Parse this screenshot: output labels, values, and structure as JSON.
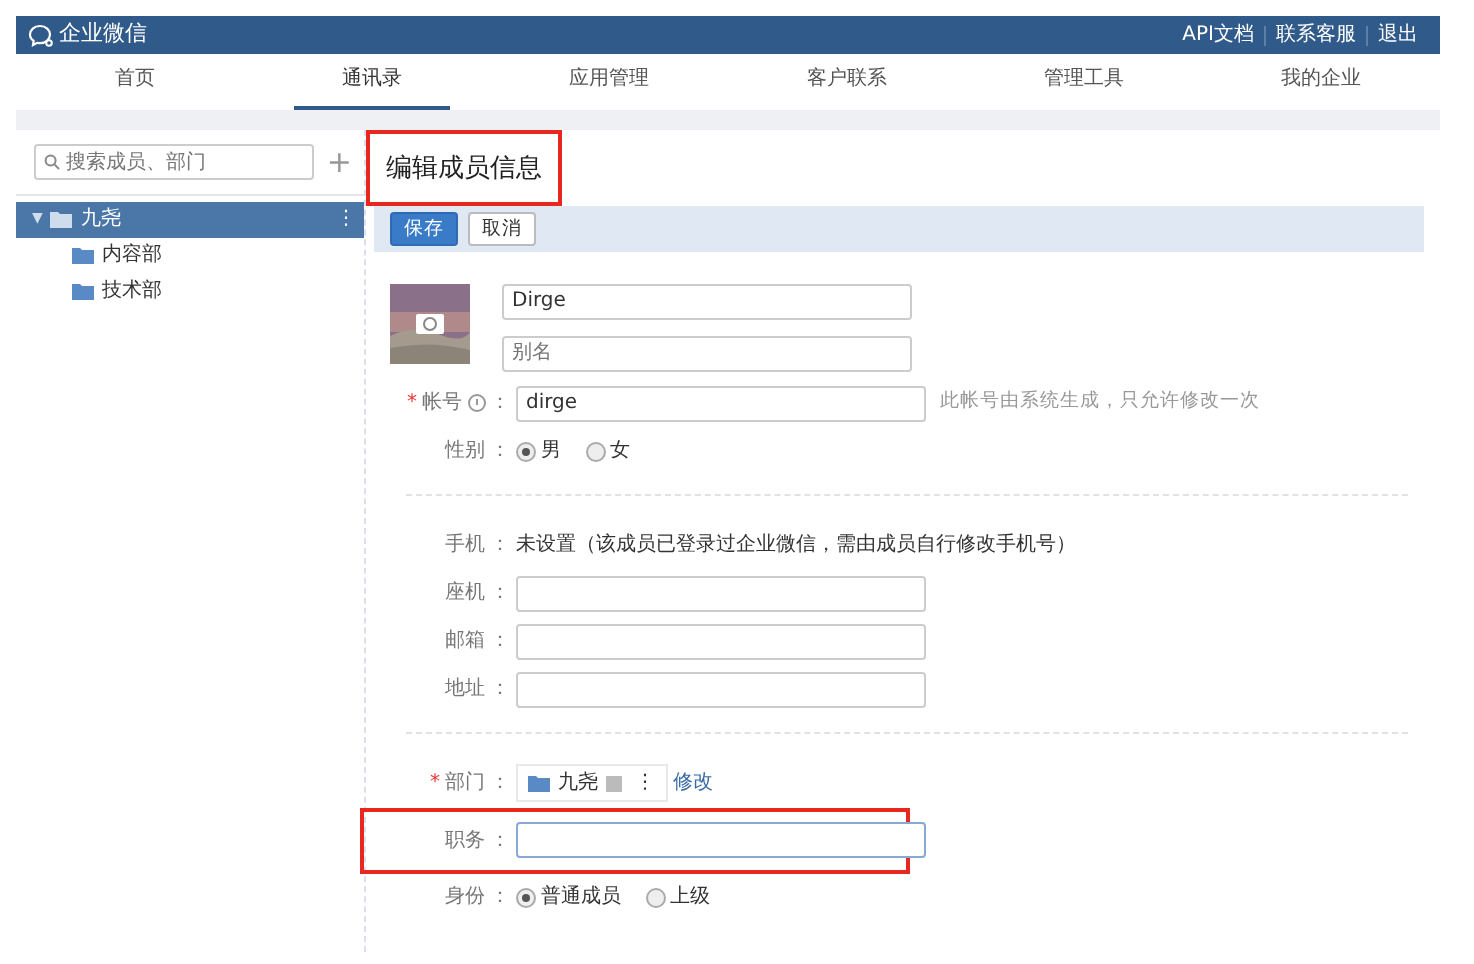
{
  "header": {
    "logo": "企业微信",
    "links": [
      "API文档",
      "联系客服",
      "退出"
    ]
  },
  "nav": [
    {
      "label": "首页",
      "selected": false
    },
    {
      "label": "通讯录",
      "selected": true
    },
    {
      "label": "应用管理",
      "selected": false
    },
    {
      "label": "客户联系",
      "selected": false
    },
    {
      "label": "管理工具",
      "selected": false
    },
    {
      "label": "我的企业",
      "selected": false
    }
  ],
  "sidebar": {
    "search_placeholder": "搜索成员、部门",
    "add": "+",
    "tree": [
      {
        "label": "九尧",
        "selected": true,
        "expanded": true,
        "caret": "▼",
        "more": "⋮",
        "children": [
          {
            "label": "内容部",
            "selected": false
          },
          {
            "label": "技术部",
            "selected": false
          }
        ]
      }
    ]
  },
  "page_title": {
    "text": "编辑成员信息",
    "highlighted": true
  },
  "toolbar": [
    {
      "label": "保存",
      "kind": "primary"
    },
    {
      "label": "取消",
      "kind": "default"
    }
  ],
  "profile": {
    "name": "Dirge",
    "alias_placeholder": "别名"
  },
  "fields": [
    {
      "kind": "text",
      "required_mark": "*",
      "label": "帐号",
      "info": true,
      "colon": "：",
      "value": "dirge",
      "hint": "此帐号由系统生成，只允许修改一次"
    },
    {
      "kind": "radio",
      "label": "性别",
      "colon": "：",
      "options": [
        {
          "label": "男",
          "selected": true
        },
        {
          "label": "女",
          "selected": false
        }
      ]
    },
    {
      "kind": "divider"
    },
    {
      "kind": "static",
      "label": "手机",
      "colon": "：",
      "value": "未设置（该成员已登录过企业微信，需由成员自行修改手机号）"
    },
    {
      "kind": "text",
      "label": "座机",
      "colon": "："
    },
    {
      "kind": "text",
      "label": "邮箱",
      "colon": "："
    },
    {
      "kind": "text",
      "label": "地址",
      "colon": "："
    },
    {
      "kind": "divider"
    },
    {
      "kind": "department",
      "required_mark": "*",
      "label": "部门",
      "colon": "：",
      "chip": "九尧",
      "more": "⋮",
      "action": "修改"
    },
    {
      "kind": "text",
      "label": "职务",
      "colon": "：",
      "focused": true,
      "highlighted": true
    },
    {
      "kind": "radio",
      "label": "身份",
      "colon": "：",
      "options": [
        {
          "label": "普通成员",
          "selected": true
        },
        {
          "label": "上级",
          "selected": false
        }
      ]
    }
  ]
}
